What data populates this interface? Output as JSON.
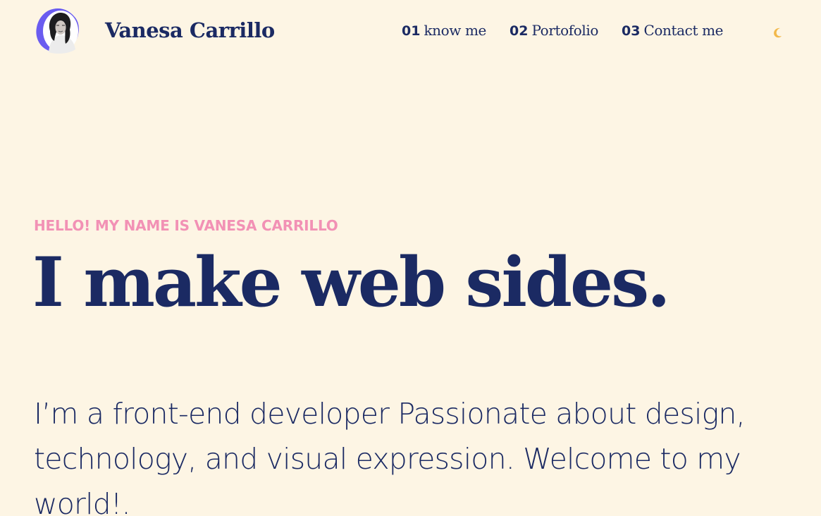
{
  "header": {
    "brand_name": "Vanesa Carrillo",
    "avatar_icon": "profile-photo",
    "nav": [
      {
        "number": "01",
        "label": "know me"
      },
      {
        "number": "02",
        "label": "Portofolio"
      },
      {
        "number": "03",
        "label": "Contact me"
      }
    ],
    "theme_toggle_icon": "moon-icon"
  },
  "hero": {
    "eyebrow": "HELLO! MY NAME IS VANESA CARRILLO",
    "headline": "I make web sides.",
    "intro": "I’m a front-end developer Passionate about design, technology, and visual expression. Welcome to my world!."
  },
  "colors": {
    "background": "#fdf5e4",
    "primary_text": "#1b2a63",
    "accent_pink": "#f291b5",
    "avatar_blob": "#6a5cf0",
    "moon": "#f2b84a"
  }
}
